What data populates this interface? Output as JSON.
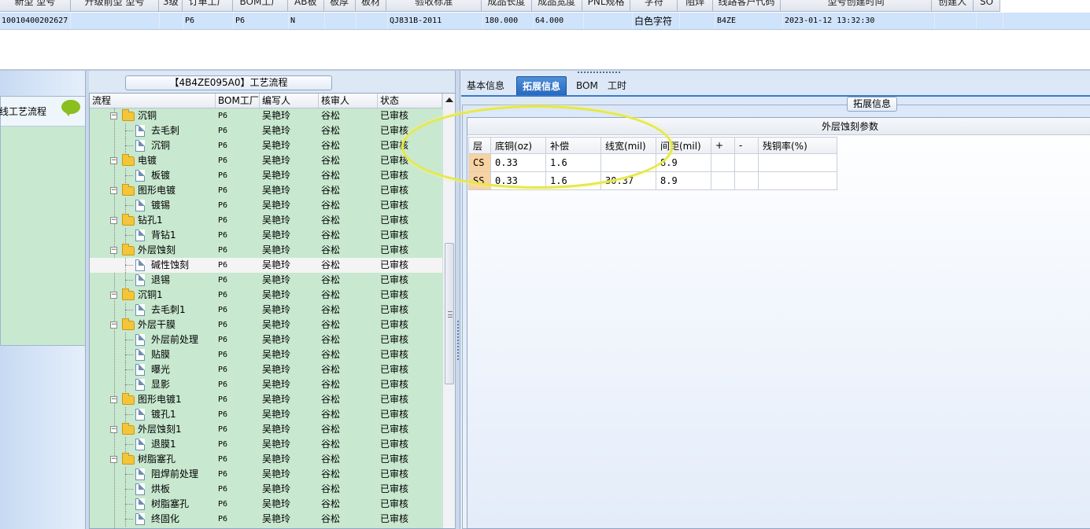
{
  "top_grid": {
    "headers": [
      {
        "label": "新型 型号",
        "w": 90
      },
      {
        "label": "升级前型 型号",
        "w": 113
      },
      {
        "label": "3级",
        "w": 30
      },
      {
        "label": "订单工厂",
        "w": 64
      },
      {
        "label": "BOM工厂",
        "w": 70
      },
      {
        "label": "AB板",
        "w": 46
      },
      {
        "label": "板厚",
        "w": 40
      },
      {
        "label": "板材",
        "w": 40
      },
      {
        "label": "验收标准",
        "w": 121
      },
      {
        "label": "成品长度",
        "w": 64
      },
      {
        "label": "成品宽度",
        "w": 64
      },
      {
        "label": "PNL规格",
        "w": 62
      },
      {
        "label": "字符",
        "w": 60
      },
      {
        "label": "阻焊",
        "w": 45
      },
      {
        "label": "线路客户代码",
        "w": 86
      },
      {
        "label": "型号创建时间",
        "w": 193
      },
      {
        "label": "创建人",
        "w": 53
      },
      {
        "label": "SO",
        "w": 34
      }
    ],
    "row": [
      "10010400202627",
      "",
      "",
      "P6",
      "P6",
      "N",
      "",
      "",
      "QJ831B-2011",
      "180.000",
      "64.000",
      "",
      "白色字符",
      "",
      "B4ZE",
      "2023-01-12 13:32:30",
      "",
      ""
    ]
  },
  "left_panel": {
    "label": "线工艺流程"
  },
  "tree_panel": {
    "title": "【4B4ZE095A0】工艺流程",
    "columns": [
      "流程",
      "BOM工厂",
      "编写人",
      "核审人",
      "状态"
    ],
    "rows": [
      {
        "level": 0,
        "name": "沉铜",
        "bom": "P6",
        "writer": "吴艳玲",
        "reviewer": "谷松",
        "status": "已审核"
      },
      {
        "level": 1,
        "name": "去毛刺",
        "bom": "P6",
        "writer": "吴艳玲",
        "reviewer": "谷松",
        "status": "已审核"
      },
      {
        "level": 1,
        "name": "沉铜",
        "bom": "P6",
        "writer": "吴艳玲",
        "reviewer": "谷松",
        "status": "已审核"
      },
      {
        "level": 0,
        "name": "电镀",
        "bom": "P6",
        "writer": "吴艳玲",
        "reviewer": "谷松",
        "status": "已审核"
      },
      {
        "level": 1,
        "name": "板镀",
        "bom": "P6",
        "writer": "吴艳玲",
        "reviewer": "谷松",
        "status": "已审核"
      },
      {
        "level": 0,
        "name": "图形电镀",
        "bom": "P6",
        "writer": "吴艳玲",
        "reviewer": "谷松",
        "status": "已审核"
      },
      {
        "level": 1,
        "name": "镀锡",
        "bom": "P6",
        "writer": "吴艳玲",
        "reviewer": "谷松",
        "status": "已审核"
      },
      {
        "level": 0,
        "name": "钻孔1",
        "bom": "P6",
        "writer": "吴艳玲",
        "reviewer": "谷松",
        "status": "已审核"
      },
      {
        "level": 1,
        "name": "背钻1",
        "bom": "P6",
        "writer": "吴艳玲",
        "reviewer": "谷松",
        "status": "已审核"
      },
      {
        "level": 0,
        "name": "外层蚀刻",
        "bom": "P6",
        "writer": "吴艳玲",
        "reviewer": "谷松",
        "status": "已审核"
      },
      {
        "level": 1,
        "name": "碱性蚀刻",
        "bom": "P6",
        "writer": "吴艳玲",
        "reviewer": "谷松",
        "status": "已审核",
        "selected": true
      },
      {
        "level": 1,
        "name": "退锡",
        "bom": "P6",
        "writer": "吴艳玲",
        "reviewer": "谷松",
        "status": "已审核"
      },
      {
        "level": 0,
        "name": "沉铜1",
        "bom": "P6",
        "writer": "吴艳玲",
        "reviewer": "谷松",
        "status": "已审核"
      },
      {
        "level": 1,
        "name": "去毛刺1",
        "bom": "P6",
        "writer": "吴艳玲",
        "reviewer": "谷松",
        "status": "已审核"
      },
      {
        "level": 0,
        "name": "外层干膜",
        "bom": "P6",
        "writer": "吴艳玲",
        "reviewer": "谷松",
        "status": "已审核"
      },
      {
        "level": 1,
        "name": "外层前处理",
        "bom": "P6",
        "writer": "吴艳玲",
        "reviewer": "谷松",
        "status": "已审核"
      },
      {
        "level": 1,
        "name": "贴膜",
        "bom": "P6",
        "writer": "吴艳玲",
        "reviewer": "谷松",
        "status": "已审核"
      },
      {
        "level": 1,
        "name": "曝光",
        "bom": "P6",
        "writer": "吴艳玲",
        "reviewer": "谷松",
        "status": "已审核"
      },
      {
        "level": 1,
        "name": "显影",
        "bom": "P6",
        "writer": "吴艳玲",
        "reviewer": "谷松",
        "status": "已审核"
      },
      {
        "level": 0,
        "name": "图形电镀1",
        "bom": "P6",
        "writer": "吴艳玲",
        "reviewer": "谷松",
        "status": "已审核"
      },
      {
        "level": 1,
        "name": "镀孔1",
        "bom": "P6",
        "writer": "吴艳玲",
        "reviewer": "谷松",
        "status": "已审核"
      },
      {
        "level": 0,
        "name": "外层蚀刻1",
        "bom": "P6",
        "writer": "吴艳玲",
        "reviewer": "谷松",
        "status": "已审核"
      },
      {
        "level": 1,
        "name": "退膜1",
        "bom": "P6",
        "writer": "吴艳玲",
        "reviewer": "谷松",
        "status": "已审核"
      },
      {
        "level": 0,
        "name": "树脂塞孔",
        "bom": "P6",
        "writer": "吴艳玲",
        "reviewer": "谷松",
        "status": "已审核"
      },
      {
        "level": 1,
        "name": "阻焊前处理",
        "bom": "P6",
        "writer": "吴艳玲",
        "reviewer": "谷松",
        "status": "已审核"
      },
      {
        "level": 1,
        "name": "烘板",
        "bom": "P6",
        "writer": "吴艳玲",
        "reviewer": "谷松",
        "status": "已审核"
      },
      {
        "level": 1,
        "name": "树脂塞孔",
        "bom": "P6",
        "writer": "吴艳玲",
        "reviewer": "谷松",
        "status": "已审核"
      },
      {
        "level": 1,
        "name": "终固化",
        "bom": "P6",
        "writer": "吴艳玲",
        "reviewer": "谷松",
        "status": "已审核"
      }
    ]
  },
  "tabs": [
    {
      "label": "基本信息",
      "active": false
    },
    {
      "label": "拓展信息",
      "active": true
    },
    {
      "label": "BOM",
      "active": false
    },
    {
      "label": "工时",
      "active": false
    }
  ],
  "extended": {
    "group_label": "拓展信息",
    "table_title": "外层蚀刻参数",
    "columns": [
      "层",
      "底铜(oz)",
      "补偿",
      "线宽(mil)",
      "间距(mil)",
      "+",
      "-",
      "残铜率(%)"
    ],
    "rows": [
      [
        "CS",
        "0.33",
        "1.6",
        "",
        "8.9",
        "",
        "",
        ""
      ],
      [
        "SS",
        "0.33",
        "1.6",
        "30.37",
        "8.9",
        "",
        "",
        ""
      ]
    ]
  },
  "colors": {
    "tree_bg": "#c8e8cf",
    "tab_active": "#2f74c8",
    "annotation": "#e6e84a",
    "selected_row": "#cfe3fb"
  }
}
